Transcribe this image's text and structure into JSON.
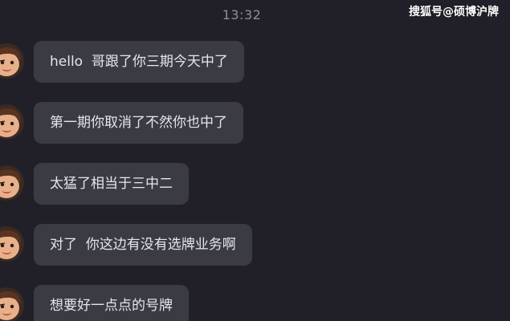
{
  "timestamp": "13:32",
  "watermark": "搜狐号@硕博沪牌",
  "messages": [
    {
      "text": "hello  哥跟了你三期今天中了"
    },
    {
      "text": "第一期你取消了不然你也中了"
    },
    {
      "text": "太猛了相当于三中二"
    },
    {
      "text": "对了  你这边有没有选牌业务啊"
    },
    {
      "text": "想要好一点点的号牌"
    }
  ],
  "colors": {
    "background": "#212029",
    "bubble": "#3b3b44",
    "bubble_text": "#e6e6ea",
    "timestamp": "#8e8e96"
  }
}
